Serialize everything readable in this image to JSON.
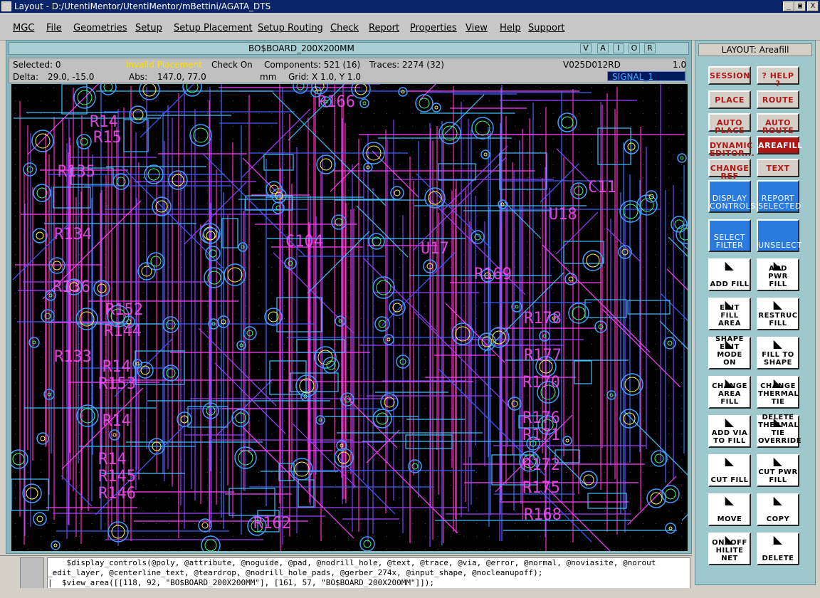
{
  "window": {
    "title": "Layout - D:/UtentiMentor/UtentiMentor/mBettini/AGATA_DTS",
    "min_glyph": "_",
    "max_glyph": "▣",
    "close_glyph": "X"
  },
  "menu": [
    "MGC",
    "File",
    "Geometries",
    "Setup",
    "Setup Placement",
    "Setup Routing",
    "Check",
    "Report",
    "Properties",
    "View",
    "Help",
    "Support"
  ],
  "document": {
    "title": "BO$BOARD_200X200MM",
    "buttons": [
      "V",
      "A",
      "I",
      "O",
      "R"
    ]
  },
  "status": {
    "selected": "Selected: 0",
    "invalid": "Invalid Placement",
    "check": "Check On",
    "components": "Components: 521 (16)",
    "traces": "Traces: 2274 (32)",
    "version": "V025D012RD",
    "scale": "1.0",
    "delta_label": "Delta:",
    "delta_value": "29.0, -15.0",
    "abs_label": "Abs:",
    "abs_value": "147.0, 77.0",
    "units": "mm",
    "grid": "Grid: X 1.0, Y 1.0",
    "layer": "SIGNAL_1"
  },
  "canvas_labels": [
    "R166",
    "R14",
    "R15",
    "R135",
    "R134",
    "C104",
    "U17",
    "R169",
    "U18",
    "C11",
    "R136",
    "R152",
    "R144",
    "R133",
    "R14",
    "R153",
    "R178",
    "R177",
    "R170",
    "R14",
    "R14",
    "R145",
    "R146",
    "R176",
    "R171",
    "R172",
    "R175",
    "R162",
    "R168"
  ],
  "panel": {
    "header": "LAYOUT: Areafill",
    "buttons": [
      {
        "label": "SESSION",
        "style": "red"
      },
      {
        "label": "? HELP ?",
        "style": "red"
      },
      {
        "label": "PLACE",
        "style": "red"
      },
      {
        "label": "ROUTE",
        "style": "red"
      },
      {
        "label": "AUTO PLACE",
        "style": "red"
      },
      {
        "label": "AUTO ROUTE",
        "style": "red"
      },
      {
        "label": "DYNAMIC EDITOR...",
        "style": "red"
      },
      {
        "label": "AREAFILL",
        "style": "redsel"
      },
      {
        "label": "CHANGE REF",
        "style": "red"
      },
      {
        "label": "TEXT",
        "style": "red"
      },
      {
        "label": "DISPLAY CONTROLS",
        "style": "blue"
      },
      {
        "label": "REPORT SELECTED",
        "style": "blue"
      },
      {
        "label": "SELECT FILTER",
        "style": "blue"
      },
      {
        "label": "UNSELECT",
        "style": "blue"
      },
      {
        "label": "ADD FILL",
        "style": "white"
      },
      {
        "label": "ADD PWR FILL",
        "style": "white"
      },
      {
        "label": "EDIT FILL AREA",
        "style": "white"
      },
      {
        "label": "RESTRUC FILL",
        "style": "white"
      },
      {
        "label": "SHAPE EDIT MODE ON",
        "style": "white"
      },
      {
        "label": "FILL TO SHAPE",
        "style": "white"
      },
      {
        "label": "CHANGE AREA FILL",
        "style": "white"
      },
      {
        "label": "CHANGE THERMAL TIE",
        "style": "white"
      },
      {
        "label": "ADD VIA TO FILL",
        "style": "white"
      },
      {
        "label": "DELETE THERMAL TIE OVERRIDE",
        "style": "white"
      },
      {
        "label": "CUT FILL",
        "style": "white"
      },
      {
        "label": "CUT PWR FILL",
        "style": "white"
      },
      {
        "label": "MOVE",
        "style": "white"
      },
      {
        "label": "COPY",
        "style": "white"
      },
      {
        "label": "ON/ OFF HILITE NET",
        "style": "white"
      },
      {
        "label": "DELETE",
        "style": "white"
      }
    ]
  },
  "command": {
    "line1": "    $display_controls(@poly, @attribute, @noguide, @pad, @nodrill_hole, @text, @trace, @via, @error, @normal, @noviasite, @norout",
    "line2": "_edit_layer, @centerline_text, @teardrop, @nodrill_hole_pads, @gerber_274x, @input_shape, @nocleanupoff);",
    "line3": "|  $view_area([[118, 92, \"BO$BOARD_200X200MM\"], [161, 57, \"BO$BOARD_200X200MM\"]]);"
  }
}
